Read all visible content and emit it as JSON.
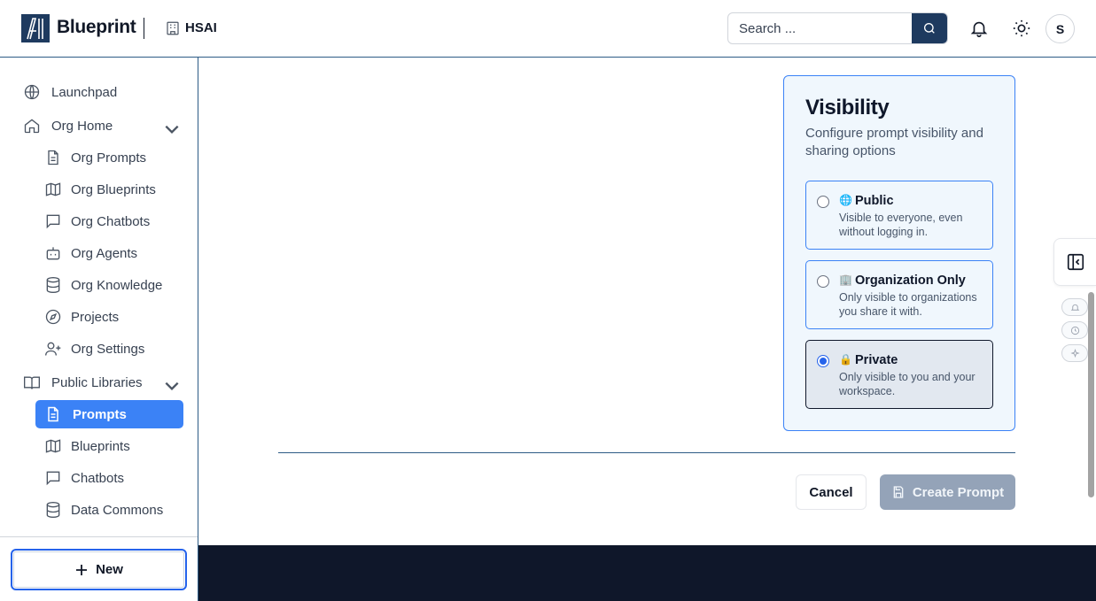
{
  "header": {
    "brand": "Blueprint",
    "org_name": "HSAI",
    "search_placeholder": "Search ...",
    "avatar_initial": "S"
  },
  "sidebar": {
    "items": [
      {
        "label": "Launchpad",
        "icon": "globe-icon"
      },
      {
        "label": "Org Home",
        "icon": "home-icon"
      },
      {
        "label": "Org Prompts",
        "icon": "document-icon"
      },
      {
        "label": "Org Blueprints",
        "icon": "map-icon"
      },
      {
        "label": "Org Chatbots",
        "icon": "chat-icon"
      },
      {
        "label": "Org Agents",
        "icon": "bot-icon"
      },
      {
        "label": "Org Knowledge",
        "icon": "database-icon"
      },
      {
        "label": "Projects",
        "icon": "compass-icon"
      },
      {
        "label": "Org Settings",
        "icon": "user-plus-icon"
      },
      {
        "label": "Public Libraries",
        "icon": "book-icon"
      },
      {
        "label": "Prompts",
        "icon": "document-icon"
      },
      {
        "label": "Blueprints",
        "icon": "map-icon"
      },
      {
        "label": "Chatbots",
        "icon": "chat-icon"
      },
      {
        "label": "Data Commons",
        "icon": "database-icon"
      }
    ],
    "new_button_label": "New"
  },
  "visibility": {
    "title": "Visibility",
    "description": "Configure prompt visibility and sharing options",
    "options": [
      {
        "emoji": "🌐",
        "title": "Public",
        "description": "Visible to everyone, even without logging in.",
        "selected": false
      },
      {
        "emoji": "🏢",
        "title": "Organization Only",
        "description": "Only visible to organizations you share it with.",
        "selected": false
      },
      {
        "emoji": "🔒",
        "title": "Private",
        "description": "Only visible to you and your workspace.",
        "selected": true
      }
    ]
  },
  "actions": {
    "cancel_label": "Cancel",
    "create_label": "Create Prompt"
  },
  "colors": {
    "brand_navy": "#1e3a5f",
    "active_nav": "#3b82f6",
    "footer": "#0f172a"
  }
}
